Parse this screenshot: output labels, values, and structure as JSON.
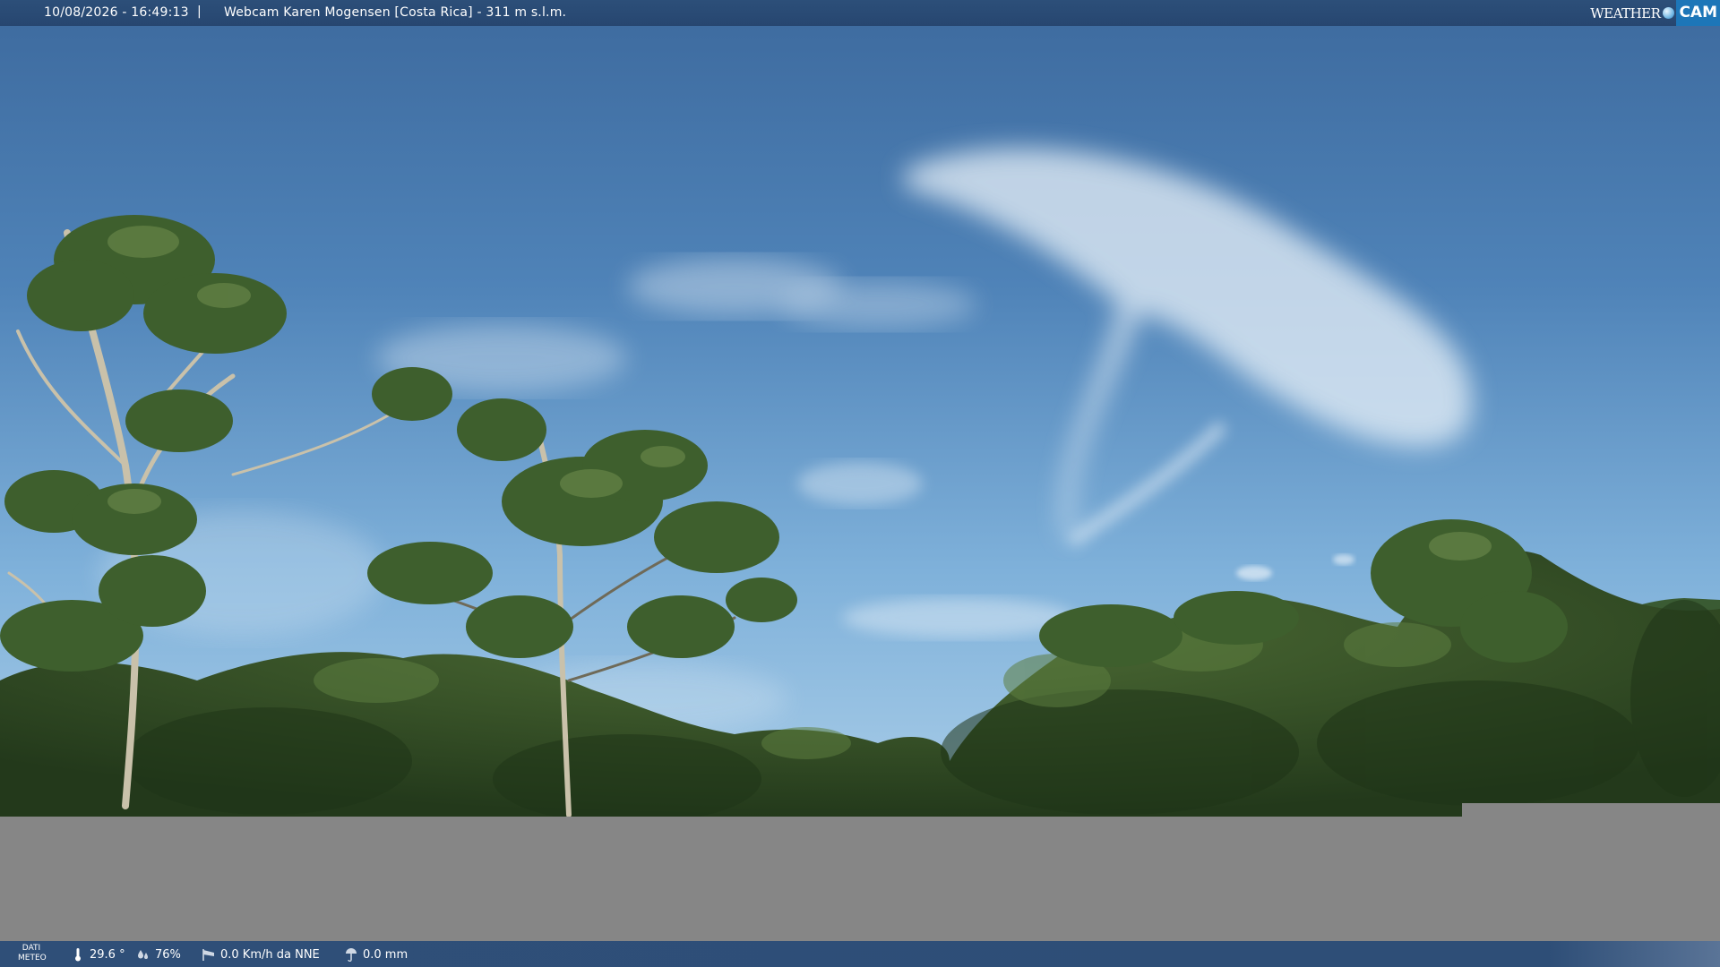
{
  "header": {
    "timestamp": "10/08/2026 - 16:49:13",
    "separator": "|",
    "camera_title": "Webcam Karen Mogensen [Costa Rica]  - 311 m s.l.m."
  },
  "brand": {
    "word1": "WEATHER",
    "word2": "CAM"
  },
  "footer": {
    "dati_line1": "DATI",
    "dati_line2": "METEO",
    "temperature": "29.6 °",
    "humidity": "76%",
    "wind": "0.0 Km/h da NNE",
    "rain": "0.0 mm",
    "icons": [
      "thermometer-icon",
      "humidity-drops-icon",
      "wind-sock-icon",
      "rain-gauge-icon"
    ]
  },
  "colors": {
    "bar_blue": "#2c4f79",
    "sky_top": "#3f6fa3",
    "sky_horizon": "#9ec6e4",
    "foliage": "#2d4a22",
    "ground_gray": "#868686"
  }
}
